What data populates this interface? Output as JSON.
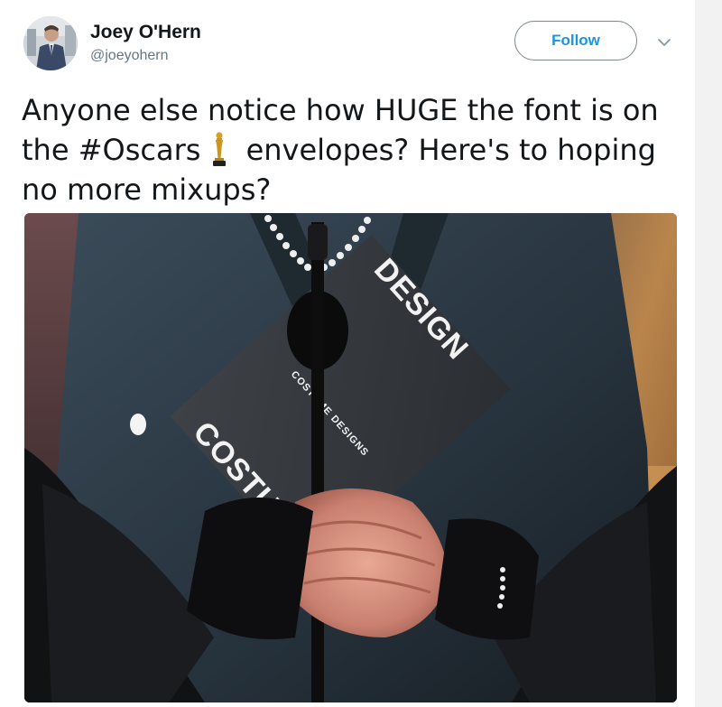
{
  "user": {
    "display_name": "Joey O'Hern",
    "handle": "@joeyohern"
  },
  "actions": {
    "follow_label": "Follow",
    "more_icon": "chevron-down-icon"
  },
  "tweet": {
    "line1": "Anyone else notice how HUGE the font is on",
    "line2_prefix": "the ",
    "hashtag": "#Oscars",
    "line2_suffix": " envelopes? Here's to hoping",
    "line3": "no more mixups?",
    "emoji_icon": "oscar-statuette-icon"
  },
  "media": {
    "envelope_text_large_left": "COSTUME",
    "envelope_text_small": "COSTUME DESIGNS",
    "envelope_text_large_right": "DESIGN"
  },
  "colors": {
    "follow_text": "#1b95e0",
    "text": "#14171a",
    "handle": "#657786"
  }
}
